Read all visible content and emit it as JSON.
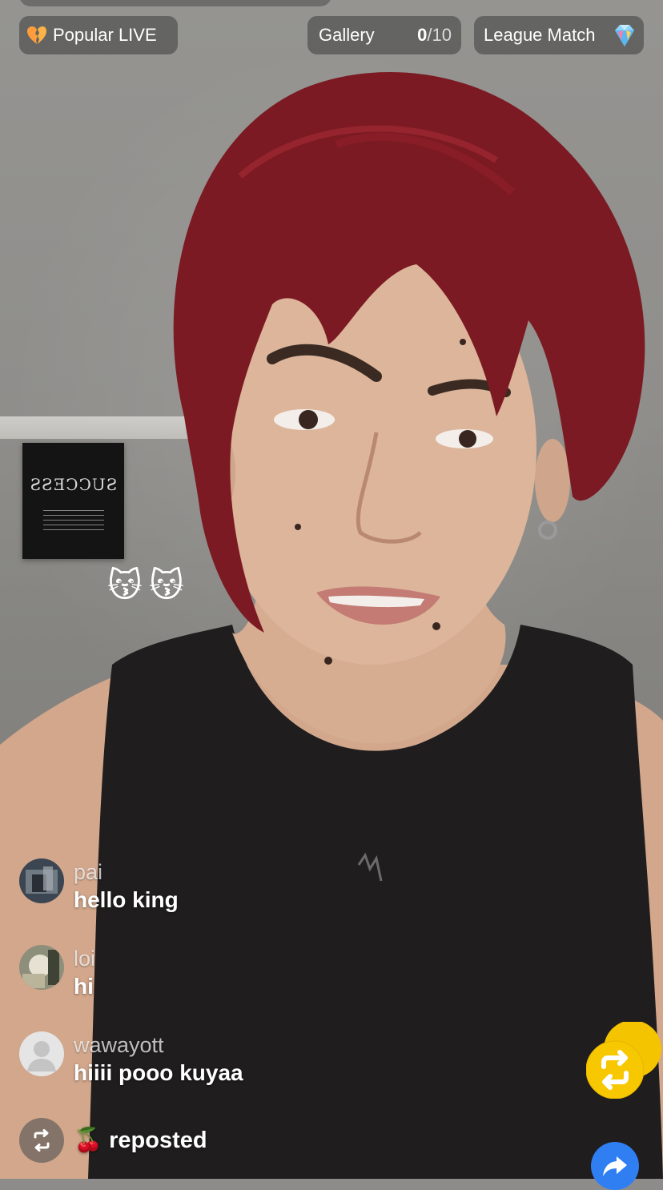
{
  "header": {
    "popular_label": "Popular LIVE",
    "gallery_label": "Gallery",
    "gallery_count_current": "0",
    "gallery_count_total": "10",
    "league_label": "League Match"
  },
  "poster": {
    "text": "SUCCESS"
  },
  "reactions": [
    "😽",
    "😽"
  ],
  "comments": [
    {
      "user": "pai",
      "message": "hello king"
    },
    {
      "user": "loi",
      "message": "hi"
    },
    {
      "user": "wawayott",
      "message": "hiiii pooo kuyaa"
    }
  ],
  "repost": {
    "emoji": "🍒",
    "label": "reposted"
  },
  "colors": {
    "chip_bg": "#3c3c3c",
    "repost_fab": "#f5c400",
    "share_button": "#2f7ff3"
  },
  "icons": {
    "popular": "broken-heart-icon",
    "league": "diamond-icon",
    "repost": "repost-icon",
    "share": "share-arrow-icon"
  }
}
